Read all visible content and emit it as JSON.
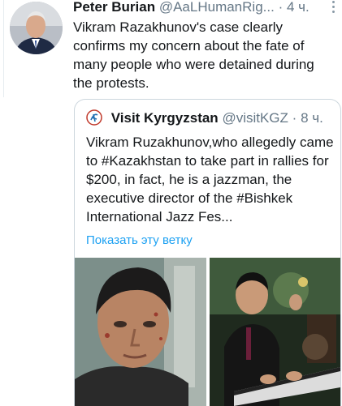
{
  "tweet": {
    "author_name": "Peter Burian",
    "author_handle": "@AaLHumanRig...",
    "separator": "·",
    "time": "4 ч.",
    "text": "Vikram Razakhunov's case clearly confirms my concern about the fate of many people who were detained during the protests."
  },
  "quoted_tweet": {
    "author_name": "Visit Kyrgyzstan",
    "author_handle": "@visitKGZ",
    "separator": "·",
    "time": "8 ч.",
    "text": "Vikram Ruzakhunov,who allegedly came to #Kazakhstan to take part in rallies for $200, in fact, he is a jazzman, the executive director of the #Bishkek International Jazz Fes...",
    "thread_link": "Показать эту ветку"
  },
  "colors": {
    "text": "#14171a",
    "secondary": "#657786",
    "link": "#1da1f2",
    "border": "#ccd6dd"
  }
}
